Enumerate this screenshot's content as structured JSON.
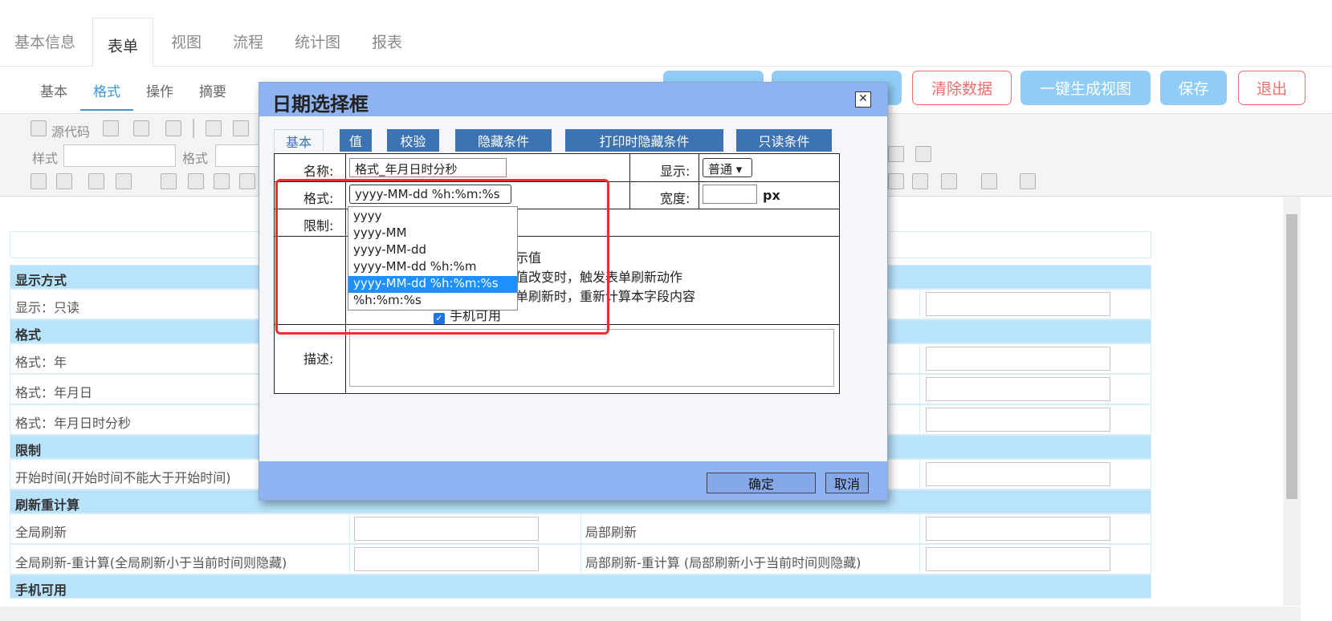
{
  "top_tabs": [
    "基本信息",
    "表单",
    "视图",
    "流程",
    "统计图",
    "报表"
  ],
  "sub_tabs": [
    "基本",
    "格式",
    "操作",
    "摘要"
  ],
  "action_buttons": {
    "clear": "清除数据",
    "generate_view": "一键生成视图",
    "save": "保存",
    "exit": "退出"
  },
  "toolbar": {
    "source": "源代码",
    "style_label": "样式",
    "format_label": "格式"
  },
  "form_sections": {
    "display_header": "显示方式",
    "display_readonly": "显示：只读",
    "format_header": "格式",
    "format_year": "格式：年",
    "format_ymd": "格式：年月日",
    "format_ymdhms": "格式：年月日时分秒",
    "limit_header": "限制",
    "limit_start": "开始时间(开始时间不能大于开始时间)",
    "refresh_header": "刷新重计算",
    "global_refresh": "全局刷新",
    "local_refresh": "局部刷新",
    "global_recalc": "全局刷新-重计算(全局刷新小于当前时间则隐藏)",
    "local_recalc": "局部刷新-重计算 (局部刷新小于当前时间则隐藏)",
    "mobile_header": "手机可用"
  },
  "dialog": {
    "title": "日期选择框",
    "close": "✕",
    "tabs": [
      "基本",
      "值",
      "校验",
      "隐藏条件",
      "打印时隐藏条件",
      "只读条件"
    ],
    "name_label": "名称:",
    "name_value": "格式_年月日时分秒",
    "display_label": "显示:",
    "display_value": "普通",
    "format_label": "格式:",
    "format_value": "yyyy-MM-dd %h:%m:%s",
    "width_label": "宽度:",
    "width_unit": "px",
    "limit_label": "限制:",
    "format_options": [
      "yyyy",
      "yyyy-MM",
      "yyyy-MM-dd",
      "yyyy-MM-dd %h:%m",
      "yyyy-MM-dd %h:%m:%s",
      "%h:%m:%s"
    ],
    "selected_option": "yyyy-MM-dd %h:%m:%s",
    "check_partial_1": "示值",
    "check_partial_2": "值改变时，触发表单刷新动作",
    "check_partial_3": "单刷新时，重新计算本字段内容",
    "check_mobile": "手机可用",
    "desc_label": "描述:",
    "ok": "确定",
    "cancel": "取消"
  },
  "colors": {
    "accent_blue": "#3a97d6",
    "dialog_title_bg": "#8fb2f0",
    "tab_bg": "#3d73b3",
    "section_header_bg": "#b9e3fb",
    "highlight_red": "#e8312f",
    "selected_option_bg": "#1e90ff"
  }
}
